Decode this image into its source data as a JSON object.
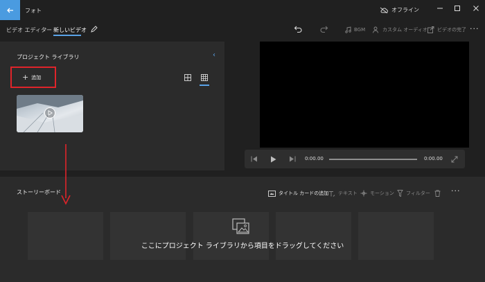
{
  "app": {
    "title": "フォト"
  },
  "status": {
    "offline_label": "オフライン"
  },
  "breadcrumb": {
    "parent": "ビデオ エディター",
    "current": "新しいビデオ"
  },
  "toolbar": {
    "bgm_label": "BGM",
    "custom_audio_label": "カスタム オーディオ",
    "finish_label": "ビデオの完了"
  },
  "library": {
    "title": "プロジェクト ライブラリ",
    "add_label": "追加"
  },
  "player": {
    "current_time": "0:00.00",
    "total_time": "0:00.00"
  },
  "storyboard": {
    "title": "ストーリーボード",
    "title_card_label": "タイトル カードの追加",
    "text_label": "テキスト",
    "motion_label": "モーション",
    "filter_label": "フィルター",
    "drop_hint": "ここにプロジェクト ライブラリから項目をドラッグしてください"
  },
  "colors": {
    "accent": "#4a9be0",
    "highlight": "#e0242a",
    "preview": "#000000"
  }
}
